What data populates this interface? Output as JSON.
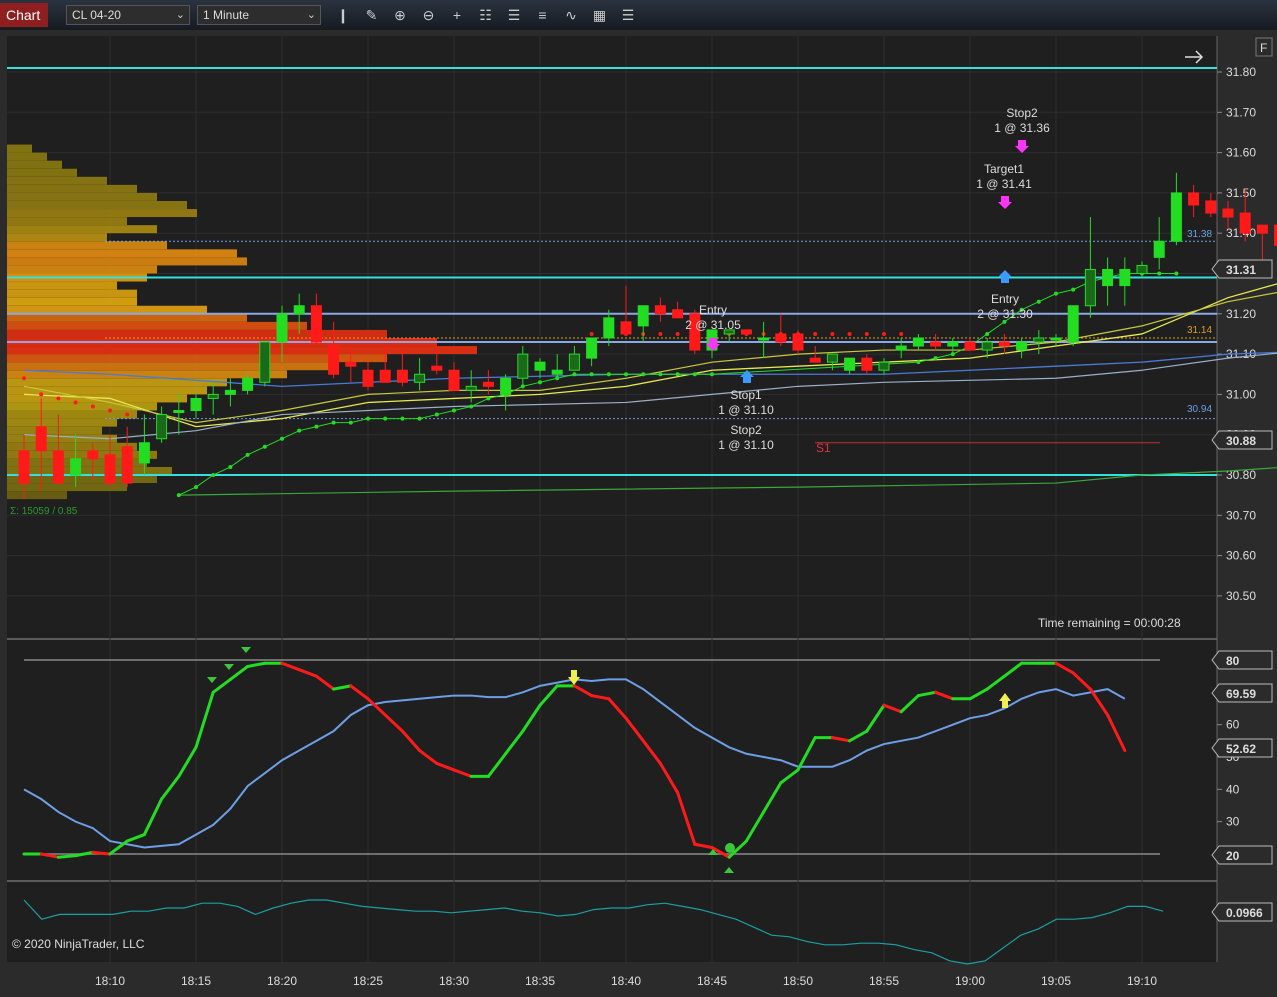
{
  "toolbar": {
    "tab_label": "Chart",
    "instrument": "CL 04-20",
    "interval": "1 Minute",
    "tool_icons": [
      "bar-type-icon",
      "drawing-tool-icon",
      "zoom-in-icon",
      "zoom-out-icon",
      "crosshair-icon",
      "data-box-icon",
      "chart-trader-icon",
      "strategies-icon",
      "indicators-icon",
      "templates-icon",
      "properties-icon"
    ]
  },
  "price_panel": {
    "corner_button": "F",
    "arrow_icon": "right-arrow-icon",
    "time_remaining": "Time remaining = 00:00:28",
    "volume_profile_label": "Σ: 15059 / 0.85",
    "s1_label": "S1",
    "ref_labels": {
      "top": "31.38",
      "mid": "31.14",
      "low": "30.94"
    },
    "last_price": "31.31",
    "s1_price": "30.88",
    "ticks": [
      "31.80",
      "31.70",
      "31.60",
      "31.50",
      "31.40",
      "31.30",
      "31.20",
      "31.10",
      "31.00",
      "30.90",
      "30.80",
      "30.70",
      "30.60",
      "30.50"
    ],
    "annotations": [
      {
        "lines": [
          "Stop2",
          "1 @ 31.36"
        ]
      },
      {
        "lines": [
          "Target1",
          "1 @ 31.41"
        ]
      },
      {
        "lines": [
          "Entry",
          "2 @ 31.05"
        ]
      },
      {
        "lines": [
          "Entry",
          "2 @ 31.30"
        ]
      },
      {
        "lines": [
          "Stop1",
          "1 @ 31.10"
        ]
      },
      {
        "lines": [
          "Stop2",
          "1 @ 31.10"
        ]
      }
    ]
  },
  "osc_panel": {
    "ticks": [
      "70",
      "60",
      "50",
      "40",
      "30"
    ],
    "badges": [
      "80",
      "69.59",
      "52.62",
      "20"
    ]
  },
  "lower_panel": {
    "badge": "0.0966"
  },
  "time_axis": [
    "18:10",
    "18:15",
    "18:20",
    "18:25",
    "18:30",
    "18:35",
    "18:40",
    "18:45",
    "18:50",
    "18:55",
    "19:00",
    "19:05",
    "19:10"
  ],
  "copyright": "© 2020 NinjaTrader, LLC",
  "colors": {
    "up": "#22dd22",
    "down": "#ff1a1a",
    "cyan": "#33e0e0",
    "blue": "#6e9fe6",
    "yellow": "#e8e850",
    "bg": "#1f1f1f"
  }
}
